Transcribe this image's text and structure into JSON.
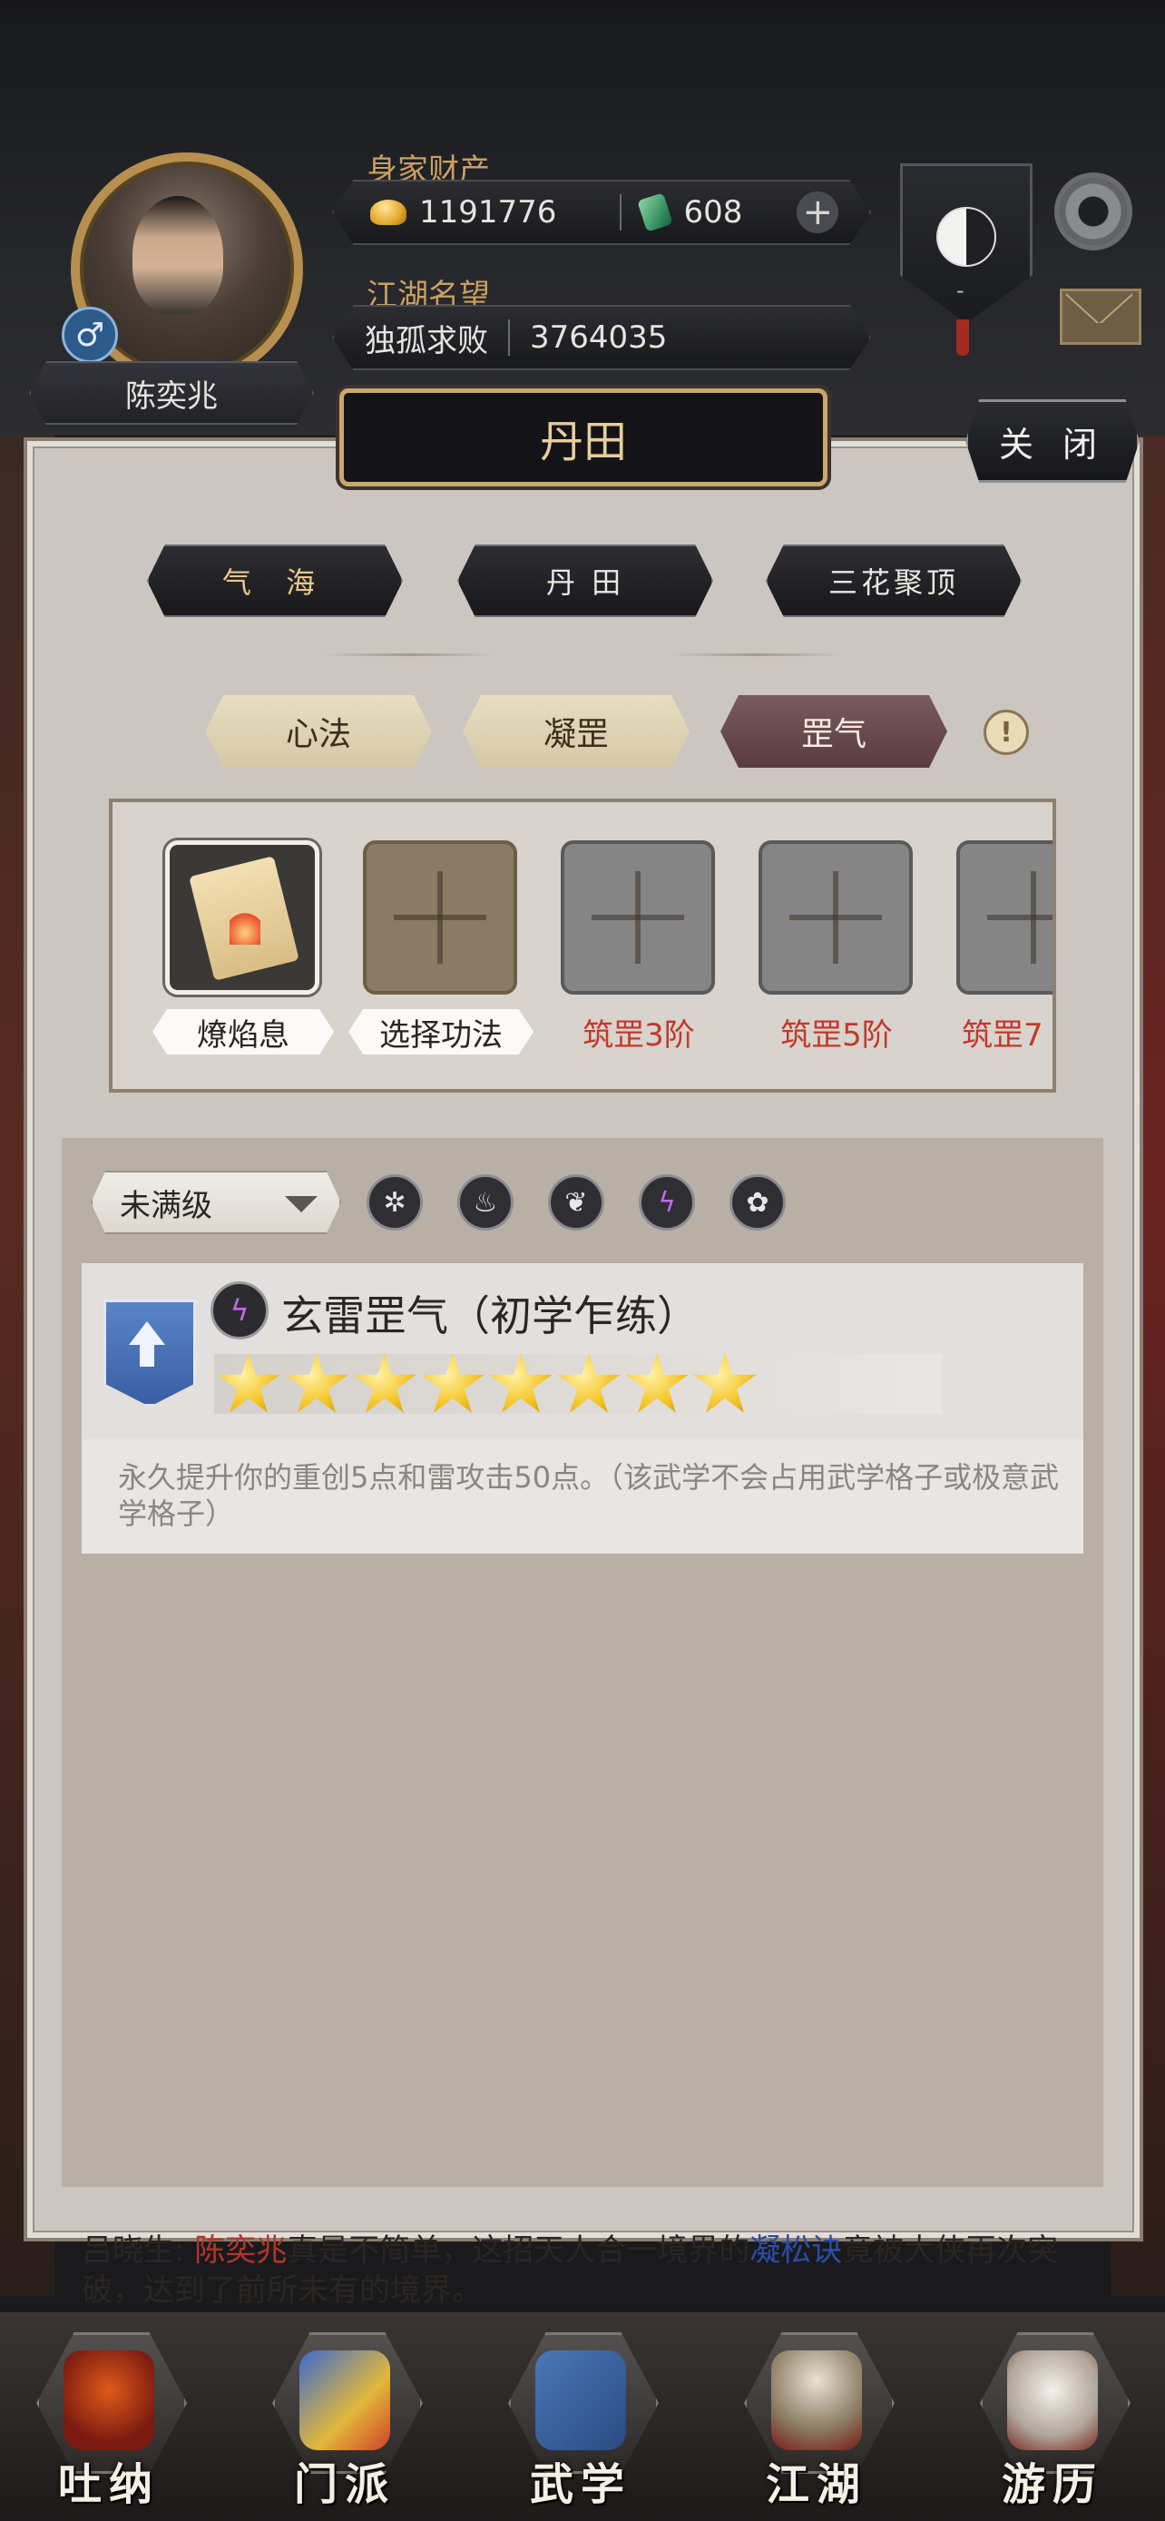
{
  "header": {
    "player_name": "陈奕兆",
    "wealth_label": "身家财产",
    "gold": "1191776",
    "jade": "608",
    "reputation_label": "江湖名望",
    "reputation_title": "独孤求败",
    "reputation_value": "3764035",
    "sect_badge_text": "-",
    "gender_symbol": "♂",
    "add_symbol": "+"
  },
  "panel": {
    "title": "丹田",
    "close_label": "关 闭",
    "top_tabs": [
      {
        "label": "气 海",
        "active": true
      },
      {
        "label": "丹 田",
        "active": false
      },
      {
        "label": "三花聚顶",
        "active": false
      }
    ],
    "sub_tabs": [
      {
        "label": "心法",
        "active": false
      },
      {
        "label": "凝罡",
        "active": false
      },
      {
        "label": "罡气",
        "active": true
      }
    ],
    "info_symbol": "!",
    "slots": [
      {
        "label": "燎焰息",
        "state": "equipped",
        "icon": "flame-book-icon"
      },
      {
        "label": "选择功法",
        "state": "empty"
      },
      {
        "label": "筑罡3阶",
        "state": "locked"
      },
      {
        "label": "筑罡5阶",
        "state": "locked"
      },
      {
        "label": "筑罡7",
        "state": "locked"
      }
    ],
    "filter": {
      "selected": "未满级",
      "elements": [
        "wind-icon",
        "fire-icon",
        "wood-icon",
        "thunder-icon",
        "lotus-icon"
      ]
    },
    "skill": {
      "name": "玄雷罡气（初学乍练）",
      "stars": 8,
      "description": "永久提升你的重创5点和雷攻击50点。（该武学不会占用武学格子或极意武学格子）"
    }
  },
  "chat": {
    "prefix": "吕晓生: ",
    "name": "陈奕兆",
    "mid": "真是不简单，这招天人合一境界的",
    "kungfu": "凝松诀",
    "suffix": "竟被大侠再次突破，达到了前所未有的境界。"
  },
  "nav": [
    {
      "label": "吐纳",
      "active": true
    },
    {
      "label": "门派",
      "active": false
    },
    {
      "label": "武学",
      "active": false
    },
    {
      "label": "江湖",
      "active": false
    },
    {
      "label": "游历",
      "active": false
    }
  ],
  "colors": {
    "accent_gold": "#e6cf9c",
    "locked_red": "#c0392b",
    "active_tab": "#5a3c40"
  }
}
